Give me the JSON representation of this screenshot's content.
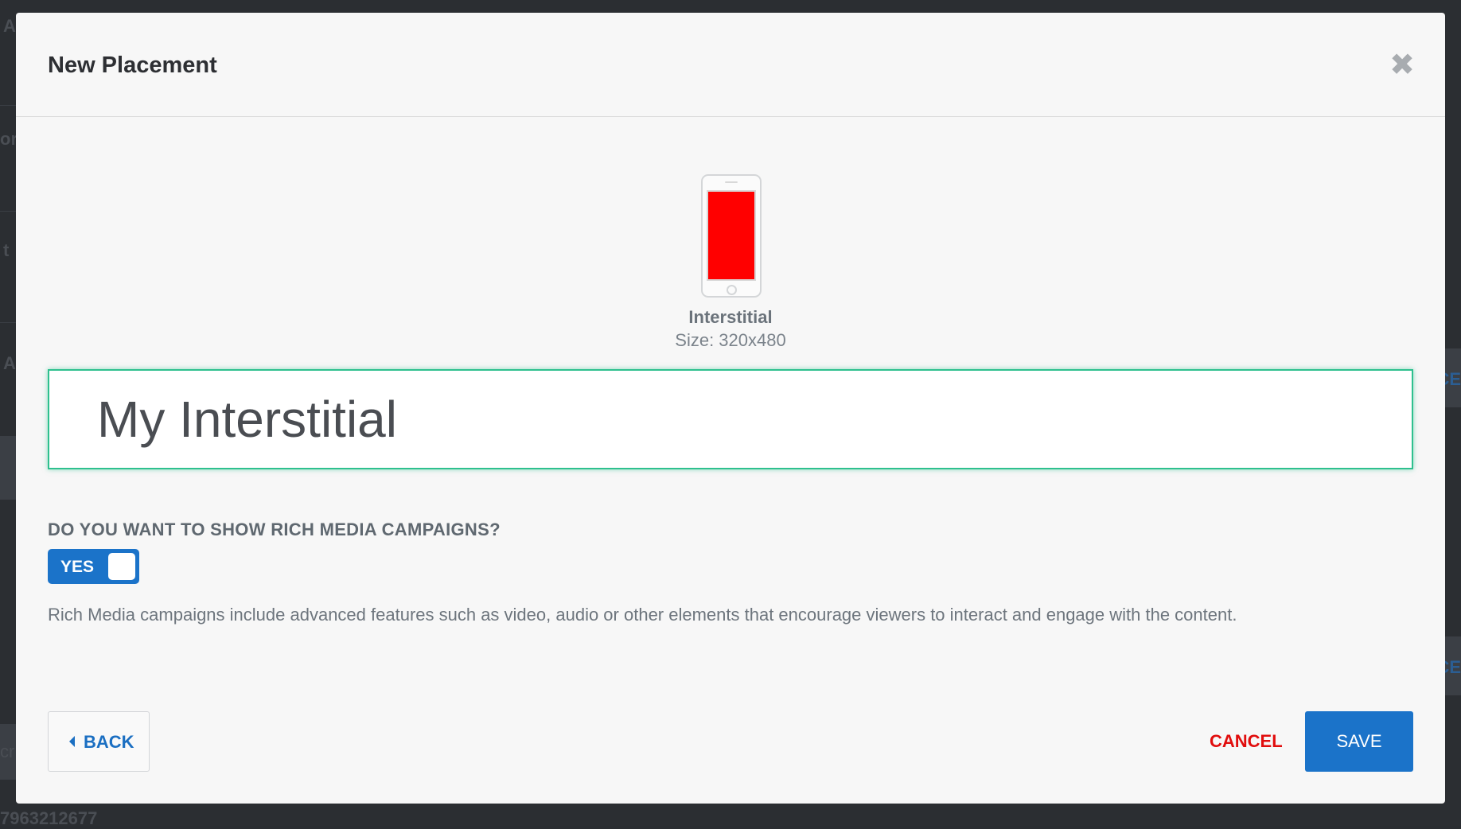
{
  "background": {
    "fragments": [
      "A",
      "or",
      "t",
      "A",
      "CE",
      "CE",
      "cr",
      "7963212677"
    ]
  },
  "modal": {
    "title": "New Placement",
    "close_icon": "close-icon"
  },
  "placement": {
    "device_icon": "phone-icon",
    "preview_color": "#ff0000",
    "type_name": "Interstitial",
    "size_text": "Size: 320x480"
  },
  "name_input": {
    "value": "My Interstitial"
  },
  "rich_media": {
    "question": "DO YOU WANT TO SHOW RICH MEDIA CAMPAIGNS?",
    "toggle_label": "YES",
    "toggle_on": true,
    "description": "Rich Media campaigns include advanced features such as video, audio or other elements that encourage viewers to interact and engage with the content."
  },
  "footer": {
    "back_label": "BACK",
    "cancel_label": "CANCEL",
    "save_label": "SAVE"
  },
  "colors": {
    "accent": "#1b73c9",
    "cancel": "#e10d0d",
    "focus": "#2ec08e"
  }
}
